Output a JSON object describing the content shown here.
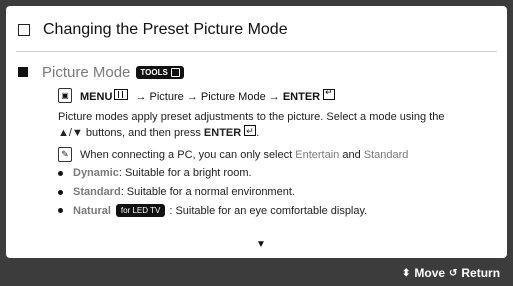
{
  "title": "Changing the Preset Picture Mode",
  "section": {
    "title": "Picture Mode",
    "tools_badge": "TOOLS",
    "menu_path": {
      "menu": "MENU",
      "p1": "Picture",
      "p2": "Picture Mode",
      "enter": "ENTER"
    }
  },
  "paragraph": {
    "line1": "Picture modes apply preset adjustments to the picture. Select a mode using the",
    "line2a": "▲/▼ buttons, and then press",
    "enter": "ENTER"
  },
  "note": {
    "before": "When connecting a PC, you can only select",
    "entertain": "Entertain",
    "and": "and",
    "standard": "Standard"
  },
  "bullets": [
    {
      "name": "Dynamic",
      "text": ": Suitable for a bright room."
    },
    {
      "name": "Standard",
      "text": ": Suitable for a normal environment."
    },
    {
      "name": "Natural",
      "badge": "for LED TV",
      "text": ": Suitable for an eye comfortable display."
    }
  ],
  "footer": {
    "move": "Move",
    "return": "Return"
  },
  "icons": {
    "more": "down-arrow-icon",
    "move": "up-down-icon",
    "return": "return-icon"
  }
}
